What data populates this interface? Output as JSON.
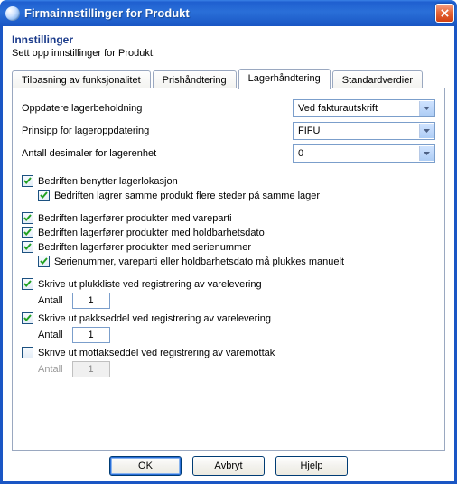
{
  "window": {
    "title": "Firmainnstillinger for Produkt",
    "close_label": "✕"
  },
  "header": {
    "title": "Innstillinger",
    "subtitle": "Sett opp innstillinger for Produkt."
  },
  "tabs": {
    "t0": "Tilpasning av funksjonalitet",
    "t1": "Prishåndtering",
    "t2": "Lagerhåndtering",
    "t3": "Standardverdier"
  },
  "form": {
    "oppdatere_label": "Oppdatere lagerbeholdning",
    "oppdatere_value": "Ved fakturautskrift",
    "prinsipp_label": "Prinsipp for lageroppdatering",
    "prinsipp_value": "FIFU",
    "desimaler_label": "Antall desimaler for lagerenhet",
    "desimaler_value": "0",
    "cb1": "Bedriften benytter lagerlokasjon",
    "cb1a": "Bedriften lagrer samme produkt flere steder på samme lager",
    "cb2": "Bedriften lagerfører produkter med vareparti",
    "cb3": "Bedriften lagerfører produkter med holdbarhetsdato",
    "cb4": "Bedriften lagerfører produkter med serienummer",
    "cb4a": "Serienummer, vareparti eller holdbarhetsdato må plukkes manuelt",
    "cb5": "Skrive ut plukkliste ved registrering av varelevering",
    "cb6": "Skrive ut pakkseddel ved registrering av varelevering",
    "cb7": "Skrive ut mottakseddel ved registrering av varemottak",
    "antall_label": "Antall",
    "antall1_value": "1",
    "antall2_value": "1",
    "antall3_value": "1"
  },
  "buttons": {
    "ok_u": "O",
    "ok_rest": "K",
    "avbryt_u": "A",
    "avbryt_rest": "vbryt",
    "hjelp_u": "H",
    "hjelp_rest": "jelp"
  }
}
